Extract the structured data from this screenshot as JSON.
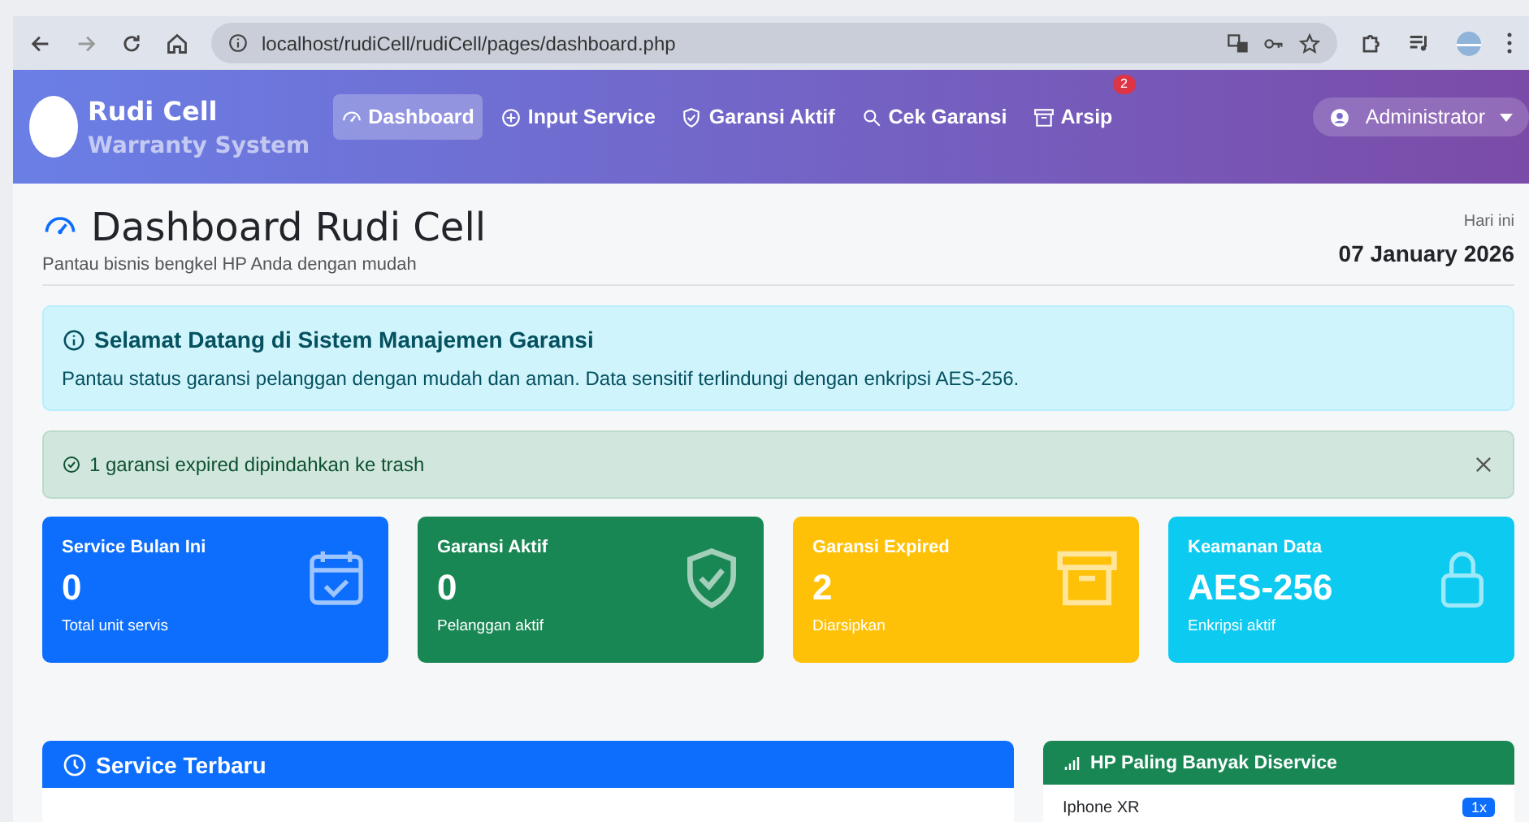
{
  "browser": {
    "url": "localhost/rudiCell/rudiCell/pages/dashboard.php"
  },
  "navbar": {
    "brand": "Rudi Cell",
    "subtitle": "Warranty System",
    "user": "Administrator",
    "items": [
      {
        "label": "Dashboard",
        "selected": true
      },
      {
        "label": "Input Service",
        "selected": false
      },
      {
        "label": "Garansi Aktif",
        "selected": false
      },
      {
        "label": "Cek Garansi",
        "selected": false
      },
      {
        "label": "Arsip",
        "selected": false,
        "badge": "2"
      }
    ]
  },
  "header": {
    "title": "Dashboard Rudi Cell",
    "subtitle": "Pantau bisnis bengkel HP Anda dengan mudah",
    "date_label": "Hari ini",
    "date": "07 January 2026"
  },
  "info_alert": {
    "title": "Selamat Datang di Sistem Manajemen Garansi",
    "text": "Pantau status garansi pelanggan dengan mudah dan aman. Data sensitif terlindungi dengan enkripsi AES-256."
  },
  "success_alert": {
    "text": "1 garansi expired dipindahkan ke trash"
  },
  "stats": [
    {
      "title": "Service Bulan Ini",
      "value": "0",
      "caption": "Total unit servis",
      "color": "#0d6efd"
    },
    {
      "title": "Garansi Aktif",
      "value": "0",
      "caption": "Pelanggan aktif",
      "color": "#198754"
    },
    {
      "title": "Garansi Expired",
      "value": "2",
      "caption": "Diarsipkan",
      "color": "#ffc107"
    },
    {
      "title": "Keamanan Data",
      "value": "AES-256",
      "caption": "Enkripsi aktif",
      "color": "#0dcaf0"
    }
  ],
  "panels": [
    {
      "title": "Service Terbaru",
      "color": "#0d6efd"
    },
    {
      "title": "HP Paling Banyak Diservice",
      "color": "#198754",
      "items": [
        {
          "name": "Iphone XR",
          "count": "1x"
        }
      ]
    }
  ]
}
